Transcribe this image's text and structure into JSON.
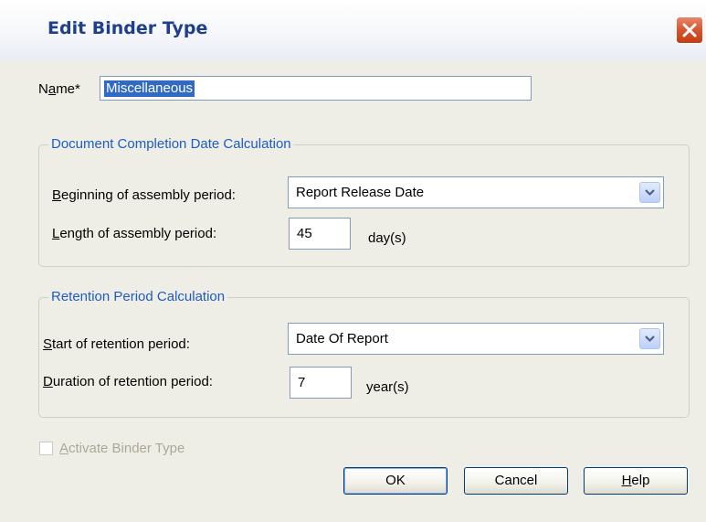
{
  "window": {
    "title": "Edit Binder Type"
  },
  "name_field": {
    "label": "Name*",
    "value": "Miscellaneous"
  },
  "completion_group": {
    "legend": "Document Completion Date Calculation",
    "beginning_label": "Beginning of assembly period:",
    "beginning_value": "Report Release Date",
    "length_label": "Length of assembly period:",
    "length_value": "45",
    "length_unit": "day(s)"
  },
  "retention_group": {
    "legend": "Retention Period Calculation",
    "start_label": "Start of retention period:",
    "start_value": "Date Of Report",
    "duration_label": "Duration of retention period:",
    "duration_value": "7",
    "duration_unit": "year(s)"
  },
  "activate": {
    "label": "Activate Binder Type",
    "checked": false,
    "enabled": false
  },
  "buttons": {
    "ok": "OK",
    "cancel": "Cancel",
    "help": "Help"
  },
  "icons": {
    "close": "close-icon",
    "dropdown": "chevron-down-icon"
  },
  "colors": {
    "title": "#1d3f8e",
    "group_legend": "#1e5bc6",
    "selection": "#316ac5",
    "close_button": "#d6552c"
  }
}
